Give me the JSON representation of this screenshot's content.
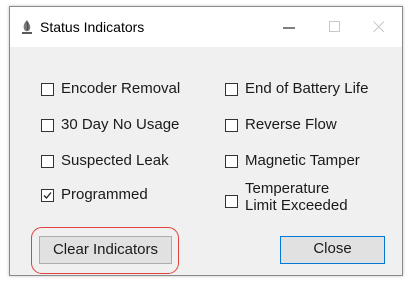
{
  "window": {
    "title": "Status Indicators",
    "controls": {
      "minimize": "minimize",
      "maximize": "maximize",
      "close": "close"
    }
  },
  "indicators": {
    "left": [
      {
        "label": "Encoder Removal",
        "checked": false
      },
      {
        "label": "30 Day No Usage",
        "checked": false
      },
      {
        "label": "Suspected Leak",
        "checked": false
      },
      {
        "label": "Programmed",
        "checked": true
      }
    ],
    "right": [
      {
        "label": "End of Battery Life",
        "checked": false
      },
      {
        "label": "Reverse Flow",
        "checked": false
      },
      {
        "label": "Magnetic Tamper",
        "checked": false
      },
      {
        "label_line1": "Temperature",
        "label_line2": "Limit Exceeded",
        "checked": false
      }
    ]
  },
  "buttons": {
    "clear_label": "Clear Indicators",
    "close_label": "Close"
  },
  "colors": {
    "highlight": "#e0433b",
    "focus_border": "#0078d7",
    "client_bg": "#f0f0f0"
  },
  "icons": [
    "app-icon",
    "minimize-icon",
    "maximize-icon",
    "close-icon",
    "checkmark-icon"
  ]
}
